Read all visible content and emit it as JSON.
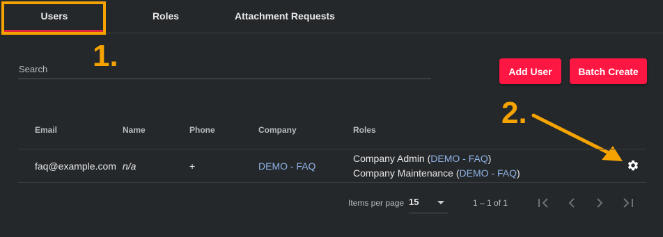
{
  "tabs": [
    {
      "label": "Users"
    },
    {
      "label": "Roles"
    },
    {
      "label": "Attachment Requests"
    }
  ],
  "annotations": {
    "step1": "1.",
    "step2": "2."
  },
  "search": {
    "placeholder": "Search"
  },
  "actions": {
    "add_user": "Add User",
    "batch_create": "Batch Create"
  },
  "table": {
    "headers": [
      "Email",
      "Name",
      "Phone",
      "Company",
      "Roles"
    ],
    "rows": [
      {
        "email": "faq@example.com",
        "name": "n/a",
        "phone": "+",
        "company": "DEMO - FAQ",
        "roles": [
          {
            "role": "Company Admin",
            "company": "DEMO - FAQ"
          },
          {
            "role": "Company Maintenance",
            "company": "DEMO - FAQ"
          }
        ]
      }
    ]
  },
  "paginator": {
    "items_per_page_label": "Items per page",
    "page_size": "15",
    "range": "1 – 1 of 1"
  },
  "colors": {
    "accent": "#ff1744",
    "callout": "#f5a300",
    "link": "#8fb3e6",
    "background": "#25282b"
  },
  "icons": [
    "gear-icon",
    "dropdown-arrow-icon",
    "first-page-icon",
    "previous-page-icon",
    "next-page-icon",
    "last-page-icon",
    "annotation-arrow-icon"
  ]
}
